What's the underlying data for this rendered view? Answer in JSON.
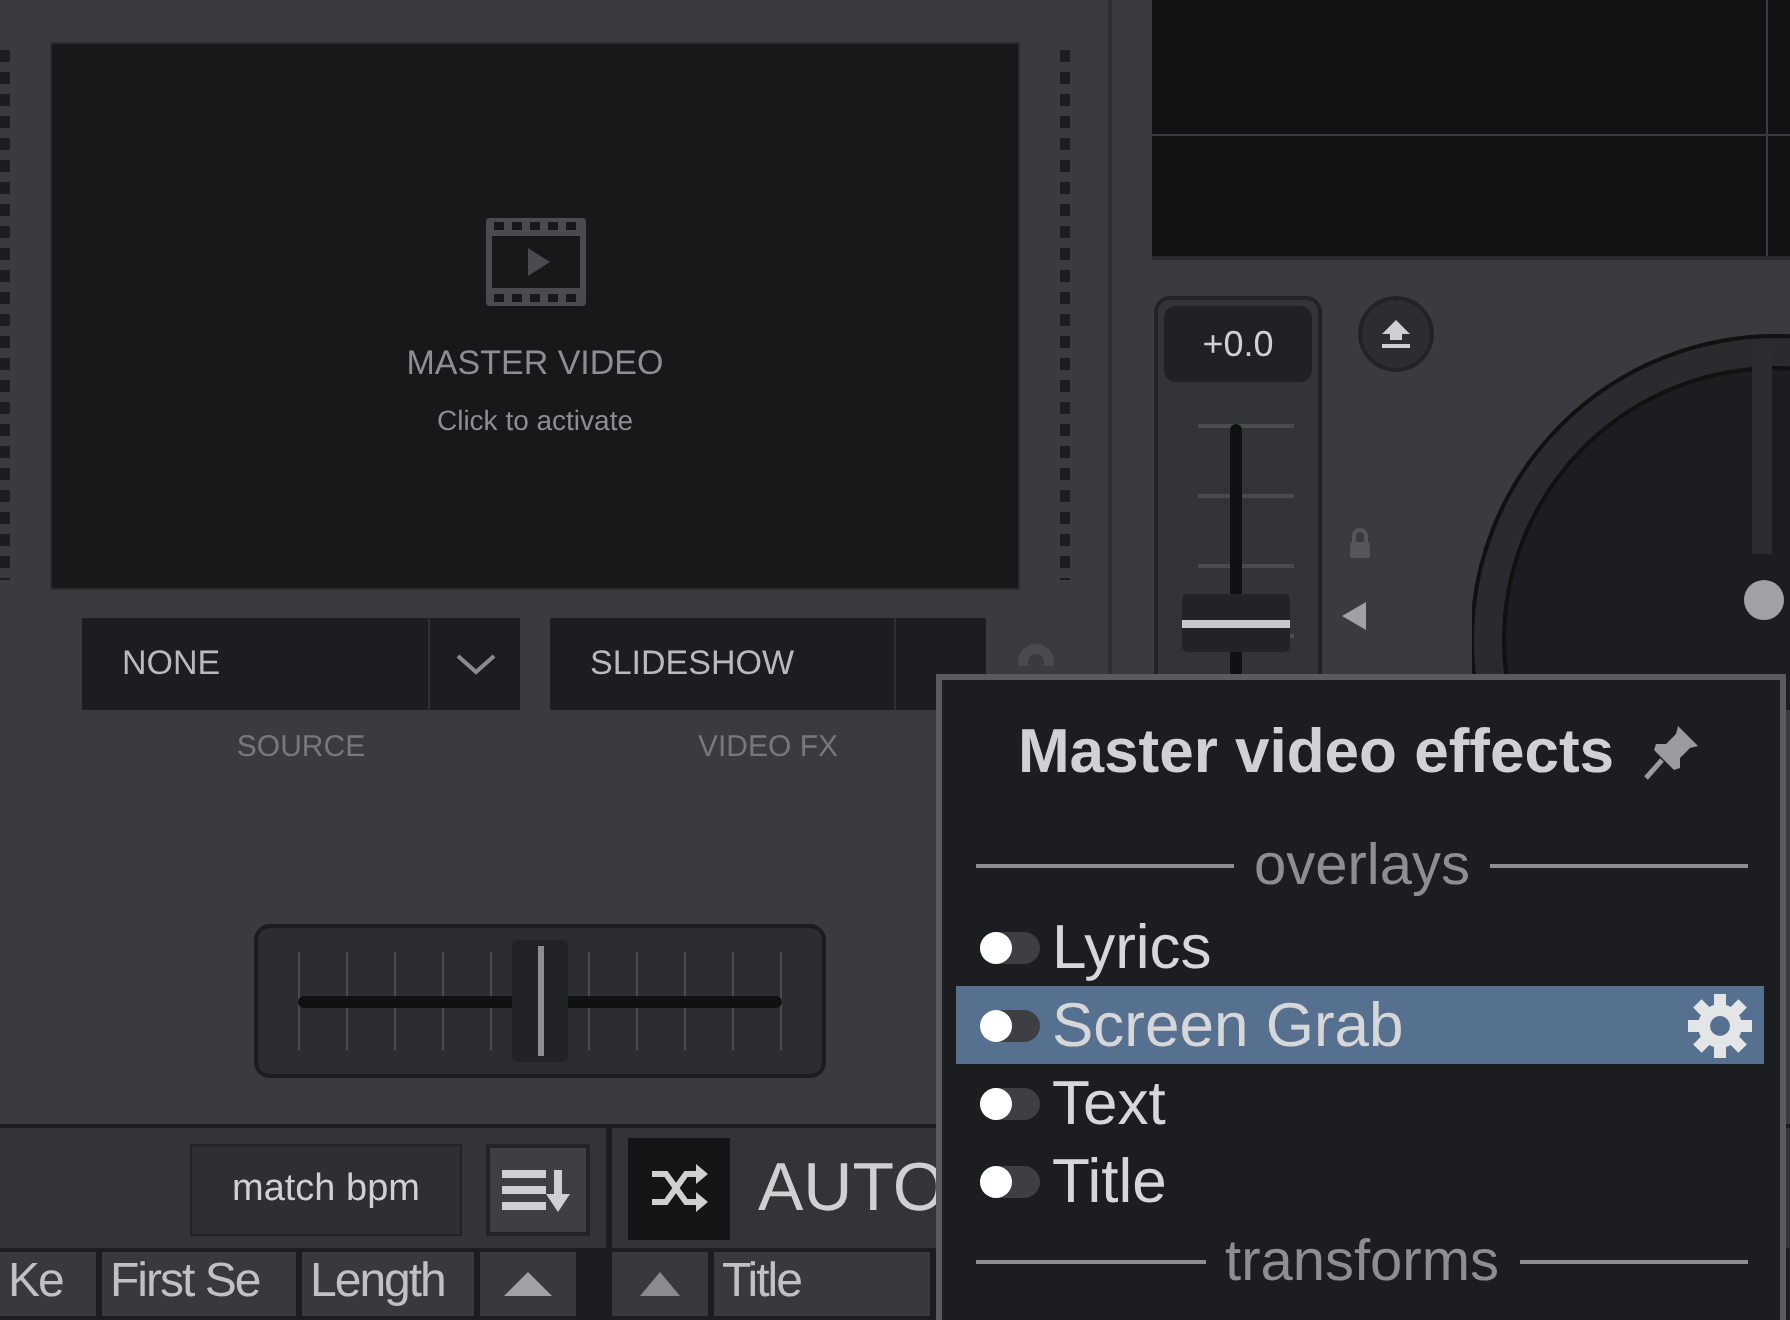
{
  "master_video": {
    "title": "MASTER VIDEO",
    "hint": "Click to activate"
  },
  "source": {
    "value": "NONE",
    "label": "SOURCE"
  },
  "video_fx": {
    "value": "SLIDESHOW",
    "label": "VIDEO FX"
  },
  "crossfader": {
    "level": 0.5
  },
  "deck": {
    "pitch_reading": "+0.0",
    "pitch": {
      "level": 0.5
    }
  },
  "browser": {
    "match_button": "match bpm",
    "columns": [
      {
        "label": "Ke"
      },
      {
        "label": "First Se"
      },
      {
        "label": "Length"
      }
    ]
  },
  "automix": {
    "label": "AUTO",
    "columns": [
      {
        "label": "Title"
      }
    ]
  },
  "popup": {
    "title": "Master video effects",
    "sections": [
      {
        "label": "overlays",
        "items": [
          {
            "label": "Lyrics",
            "on": false,
            "selected": false
          },
          {
            "label": "Screen Grab",
            "on": false,
            "selected": true
          },
          {
            "label": "Text",
            "on": false,
            "selected": false
          },
          {
            "label": "Title",
            "on": false,
            "selected": false
          }
        ]
      },
      {
        "label": "transforms"
      }
    ]
  }
}
